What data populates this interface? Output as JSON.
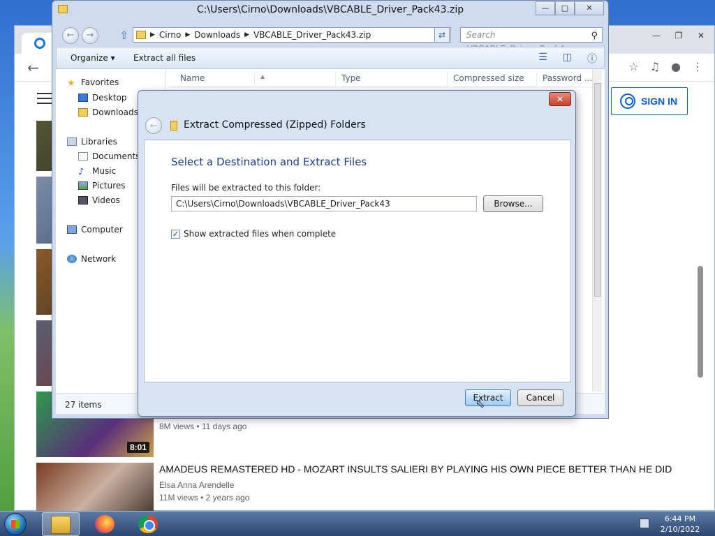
{
  "explorer": {
    "title": "C:\\Users\\Cirno\\Downloads\\VBCABLE_Driver_Pack43.zip",
    "breadcrumb": [
      "Cirno",
      "Downloads",
      "VBCABLE_Driver_Pack43.zip"
    ],
    "search_placeholder": "Search VBCABLE_Driver_Pack4...",
    "toolbar": {
      "organize": "Organize",
      "extract_all": "Extract all files"
    },
    "nav": {
      "favorites": "Favorites",
      "desktop": "Desktop",
      "downloads": "Downloads",
      "libraries": "Libraries",
      "documents": "Documents",
      "music": "Music",
      "pictures": "Pictures",
      "videos": "Videos",
      "computer": "Computer",
      "network": "Network"
    },
    "columns": [
      "Name",
      "Type",
      "Compressed size",
      "Password ..."
    ],
    "status": "27 items"
  },
  "dialog": {
    "title": "Extract Compressed (Zipped) Folders",
    "heading": "Select a Destination and Extract Files",
    "folder_label": "Files will be extracted to this folder:",
    "path": "C:\\Users\\Cirno\\Downloads\\VBCABLE_Driver_Pack43",
    "browse_label": "Browse...",
    "checkbox_label": "Show extracted files when complete",
    "checkbox_checked": true,
    "extract_label": "Extract",
    "cancel_label": "Cancel"
  },
  "browser": {
    "sign_in": "SIGN IN",
    "video1": {
      "duration": "8:01",
      "meta": "8M views • 11 days ago"
    },
    "video2": {
      "title": "AMADEUS REMASTERED HD - MOZART INSULTS SALIERI BY PLAYING HIS OWN PIECE BETTER THAN HE DID",
      "channel": "Elsa Anna Arendelle",
      "meta": "11M views • 2 years ago"
    }
  },
  "taskbar": {
    "time": "6:44 PM",
    "date": "2/10/2022"
  },
  "colors": {
    "dialog_heading": "#1e3f8a",
    "youtube_blue": "#065fd4",
    "close_red": "#c6412a"
  }
}
